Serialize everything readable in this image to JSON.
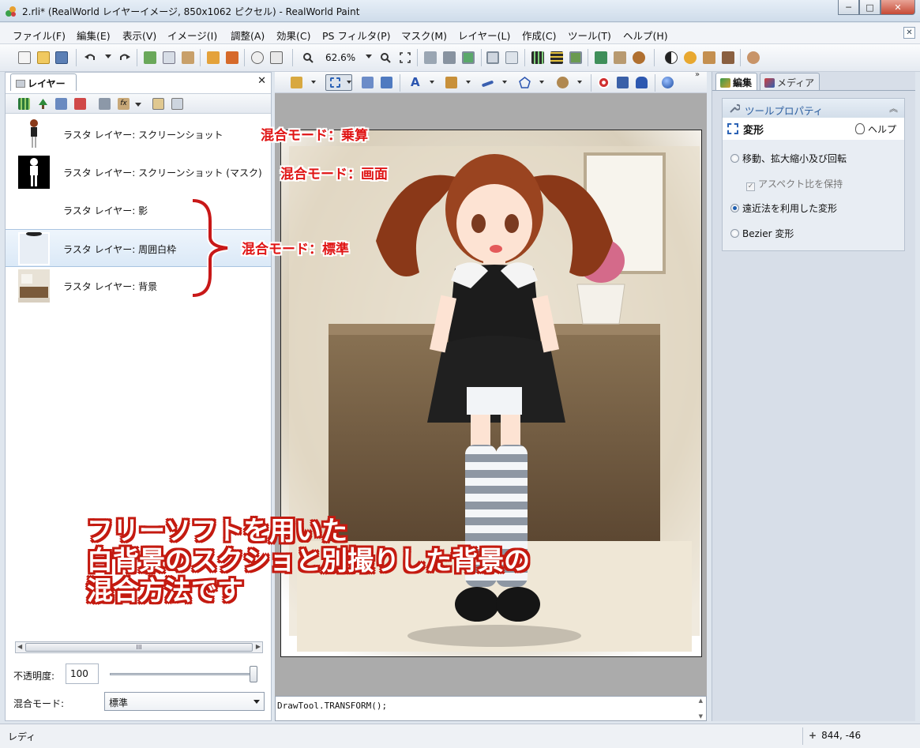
{
  "window": {
    "title": "2.rli* (RealWorld レイヤーイメージ, 850x1062 ピクセル) - RealWorld Paint",
    "minimize": "─",
    "maximize": "□",
    "close": "✕"
  },
  "menu": {
    "items": [
      "ファイル(F)",
      "編集(E)",
      "表示(V)",
      "イメージ(I)",
      "調整(A)",
      "効果(C)",
      "PS フィルタ(P)",
      "マスク(M)",
      "レイヤー(L)",
      "作成(C)",
      "ツール(T)",
      "ヘルプ(H)"
    ],
    "mdi_close": "✕"
  },
  "toolbar": {
    "zoom": "62.6%"
  },
  "layers_panel": {
    "tab_label": "レイヤー",
    "close": "✕",
    "layers": [
      {
        "name": "ラスタ レイヤー: スクリーンショット"
      },
      {
        "name": "ラスタ レイヤー: スクリーンショット (マスク)"
      },
      {
        "name": "ラスタ レイヤー: 影"
      },
      {
        "name": "ラスタ レイヤー: 周囲白枠"
      },
      {
        "name": "ラスタ レイヤー: 背景"
      }
    ],
    "scroll_grip": "III",
    "opacity_label": "不透明度:",
    "opacity_value": "100",
    "blend_label": "混合モード:",
    "blend_value": "標準"
  },
  "annotations": {
    "multiply": "混合モード：乗算",
    "screen": "混合モード：画面",
    "normal": "混合モード：標準",
    "caption_lines": [
      "フリーソフトを用いた",
      "白背景のスクショと別撮りした背景の",
      "混合方法です"
    ]
  },
  "script": {
    "text": "DrawTool.TRANSFORM();"
  },
  "right_panel": {
    "tabs": [
      "編集",
      "メディア"
    ],
    "section_title": "ツールプロパティ",
    "tool_name": "変形",
    "help": "ヘルプ",
    "options": [
      {
        "label": "移動、拡大縮小及び回転",
        "checked": false
      },
      {
        "label": "遠近法を利用した変形",
        "checked": true
      },
      {
        "label": "Bezier 変形",
        "checked": false
      }
    ],
    "aspect_label": "アスペクト比を保持",
    "collapse": "︽"
  },
  "status": {
    "text": "レディ",
    "coords": "844, -46",
    "cross": "+"
  }
}
